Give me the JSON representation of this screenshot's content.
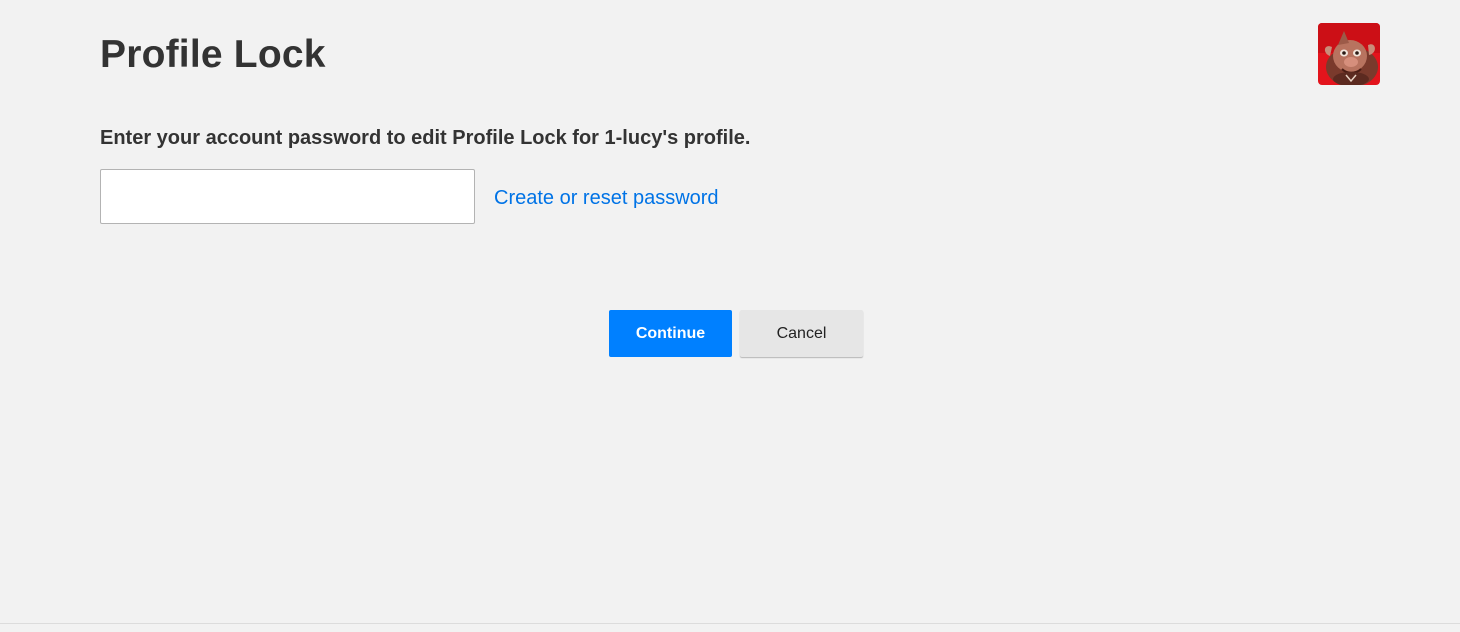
{
  "page": {
    "title": "Profile Lock"
  },
  "profile": {
    "avatar_icon": "profile-avatar-character",
    "accent_color": "#e50914"
  },
  "form": {
    "instructions": "Enter your account password to edit Profile Lock for 1-lucy's profile.",
    "password_value": "",
    "password_placeholder": "",
    "reset_link_label": "Create or reset password"
  },
  "actions": {
    "continue_label": "Continue",
    "cancel_label": "Cancel"
  },
  "colors": {
    "background": "#f2f2f2",
    "primary_button": "#0080ff",
    "link": "#0073e6",
    "secondary_button": "#e6e6e6",
    "text": "#333333"
  }
}
